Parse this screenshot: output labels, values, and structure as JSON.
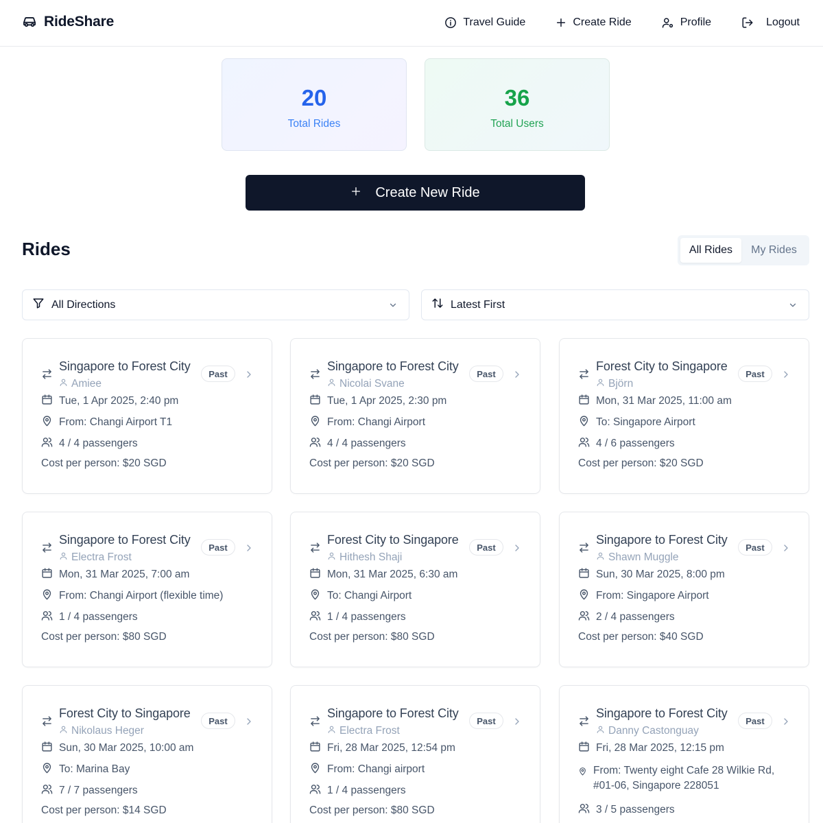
{
  "app": {
    "name": "RideShare"
  },
  "nav": {
    "travel_guide": "Travel Guide",
    "create_ride": "Create Ride",
    "profile": "Profile",
    "logout": "Logout"
  },
  "stats": {
    "rides_value": "20",
    "rides_label": "Total Rides",
    "users_value": "36",
    "users_label": "Total Users"
  },
  "create_button": "Create New Ride",
  "rides_section": {
    "title": "Rides",
    "toggle_all": "All Rides",
    "toggle_mine": "My Rides",
    "filter_direction": "All Directions",
    "sort_order": "Latest First"
  },
  "colors": {
    "primary": "#0f172a",
    "rides_accent": "#2563eb",
    "users_accent": "#16a34a"
  },
  "rides": [
    {
      "route": "Singapore to Forest City",
      "driver": "Amiee",
      "status": "Past",
      "datetime": "Tue, 1 Apr 2025, 2:40 pm",
      "location": "From: Changi Airport T1",
      "passengers": "4 / 4 passengers",
      "cost": "Cost per person: $20 SGD"
    },
    {
      "route": "Singapore to Forest City",
      "driver": "Nicolai Svane",
      "status": "Past",
      "datetime": "Tue, 1 Apr 2025, 2:30 pm",
      "location": "From: Changi Airport",
      "passengers": "4 / 4 passengers",
      "cost": "Cost per person: $20 SGD"
    },
    {
      "route": "Forest City to Singapore",
      "driver": "Björn",
      "status": "Past",
      "datetime": "Mon, 31 Mar 2025, 11:00 am",
      "location": "To: Singapore Airport",
      "passengers": "4 / 6 passengers",
      "cost": "Cost per person: $20 SGD"
    },
    {
      "route": "Singapore to Forest City",
      "driver": "Electra Frost",
      "status": "Past",
      "datetime": "Mon, 31 Mar 2025, 7:00 am",
      "location": "From: Changi Airport (flexible time)",
      "passengers": "1 / 4 passengers",
      "cost": "Cost per person: $80 SGD"
    },
    {
      "route": "Forest City to Singapore",
      "driver": "Hithesh Shaji",
      "status": "Past",
      "datetime": "Mon, 31 Mar 2025, 6:30 am",
      "location": "To: Changi Airport",
      "passengers": "1 / 4 passengers",
      "cost": "Cost per person: $80 SGD"
    },
    {
      "route": "Singapore to Forest City",
      "driver": "Shawn Muggle",
      "status": "Past",
      "datetime": "Sun, 30 Mar 2025, 8:00 pm",
      "location": "From: Singapore Airport",
      "passengers": "2 / 4 passengers",
      "cost": "Cost per person: $40 SGD"
    },
    {
      "route": "Forest City to Singapore",
      "driver": "Nikolaus Heger",
      "status": "Past",
      "datetime": "Sun, 30 Mar 2025, 10:00 am",
      "location": "To: Marina Bay",
      "passengers": "7 / 7 passengers",
      "cost": "Cost per person: $14 SGD"
    },
    {
      "route": "Singapore to Forest City",
      "driver": "Electra Frost",
      "status": "Past",
      "datetime": "Fri, 28 Mar 2025, 12:54 pm",
      "location": "From: Changi airport",
      "passengers": "1 / 4 passengers",
      "cost": "Cost per person: $80 SGD"
    },
    {
      "route": "Singapore to Forest City",
      "driver": "Danny Castonguay",
      "status": "Past",
      "datetime": "Fri, 28 Mar 2025, 12:15 pm",
      "location": "From: Twenty eight Cafe 28 Wilkie Rd, #01-06, Singapore 228051",
      "passengers": "3 / 5 passengers",
      "cost": ""
    }
  ]
}
